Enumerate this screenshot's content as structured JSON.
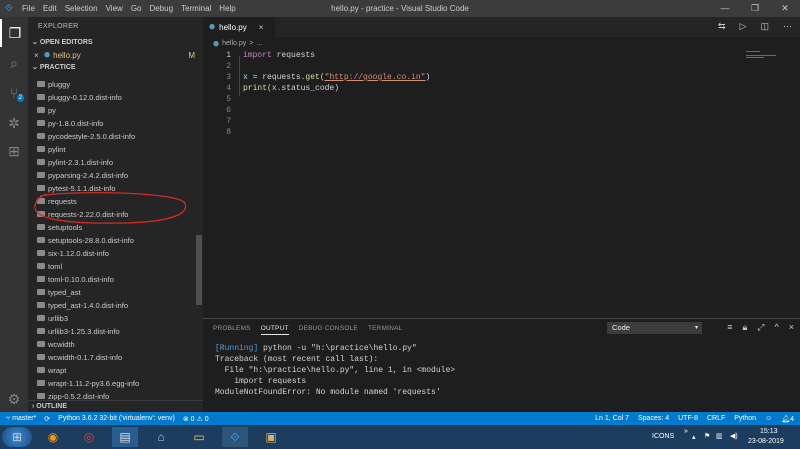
{
  "window": {
    "title": "hello.py - practice - Visual Studio Code",
    "menu": [
      "File",
      "Edit",
      "Selection",
      "View",
      "Go",
      "Debug",
      "Terminal",
      "Help"
    ],
    "controls": [
      "—",
      "❐",
      "✕"
    ]
  },
  "activity": {
    "scm_badge": "2"
  },
  "sidebar": {
    "title": "EXPLORER",
    "open_editors_label": "OPEN EDITORS",
    "open_file": "hello.py",
    "open_file_status": "M",
    "project_label": "PRACTICE",
    "folders": [
      "pluggy",
      "pluggy-0.12.0.dist-info",
      "py",
      "py-1.8.0.dist-info",
      "pycodestyle-2.5.0.dist-info",
      "pylint",
      "pylint-2.3.1.dist-info",
      "pyparsing-2.4.2.dist-info",
      "pytest-5.1.1.dist-info",
      "requests",
      "requests-2.22.0.dist-info",
      "setuptools",
      "setuptools-28.8.0.dist-info",
      "six-1.12.0.dist-info",
      "toml",
      "toml-0.10.0.dist-info",
      "typed_ast",
      "typed_ast-1.4.0.dist-info",
      "urllib3",
      "urllib3-1.25.3.dist-info",
      "wcwidth",
      "wcwidth-0.1.7.dist-info",
      "wrapt",
      "wrapt-1.11.2-py3.6.egg-info",
      "zipp-0.5.2.dist-info"
    ],
    "outline_label": "OUTLINE"
  },
  "editor": {
    "tab": "hello.py",
    "tab_close": "×",
    "breadcrumb_file": "hello.py",
    "breadcrumb_sep": ">",
    "breadcrumb_more": "...",
    "lines": [
      "1",
      "2",
      "3",
      "4",
      "5",
      "6",
      "7",
      "8"
    ],
    "code": {
      "l1_kw": "import",
      "l1_mod": " requests",
      "l3_var": "x",
      "l3_mid": " = requests.",
      "l3_fn": "get",
      "l3_open": "(",
      "l3_str": "\"http://google.co.in\"",
      "l3_close": ")",
      "l4_fn": "print",
      "l4_rest": "(x.status_code)"
    }
  },
  "panel": {
    "tabs": [
      "PROBLEMS",
      "OUTPUT",
      "DEBUG CONSOLE",
      "TERMINAL"
    ],
    "active_tab": "OUTPUT",
    "channel": "Code",
    "output": {
      "run_tag": "[Running]",
      "run_cmd": " python -u \"h:\\practice\\hello.py\"",
      "l2": "Traceback (most recent call last):",
      "l3": "  File \"h:\\practice\\hello.py\", line 1, in <module>",
      "l4": "    import requests",
      "l5": "ModuleNotFoundError: No module named 'requests'"
    }
  },
  "statusbar": {
    "branch": "master*",
    "interpreter": "Python 3.6.2 32-bit ('virtualenv': venv)",
    "errors": "0",
    "warnings": "0",
    "position": "Ln 1, Col 7",
    "spaces": "Spaces: 4",
    "encoding": "UTF-8",
    "eol": "CRLF",
    "language": "Python",
    "notifications": "4"
  },
  "taskbar": {
    "icons_label": "ICONS",
    "time": "15:13",
    "date": "23-08-2019"
  },
  "colors": {
    "accent": "#007acc",
    "annotation": "#d42a2a"
  }
}
